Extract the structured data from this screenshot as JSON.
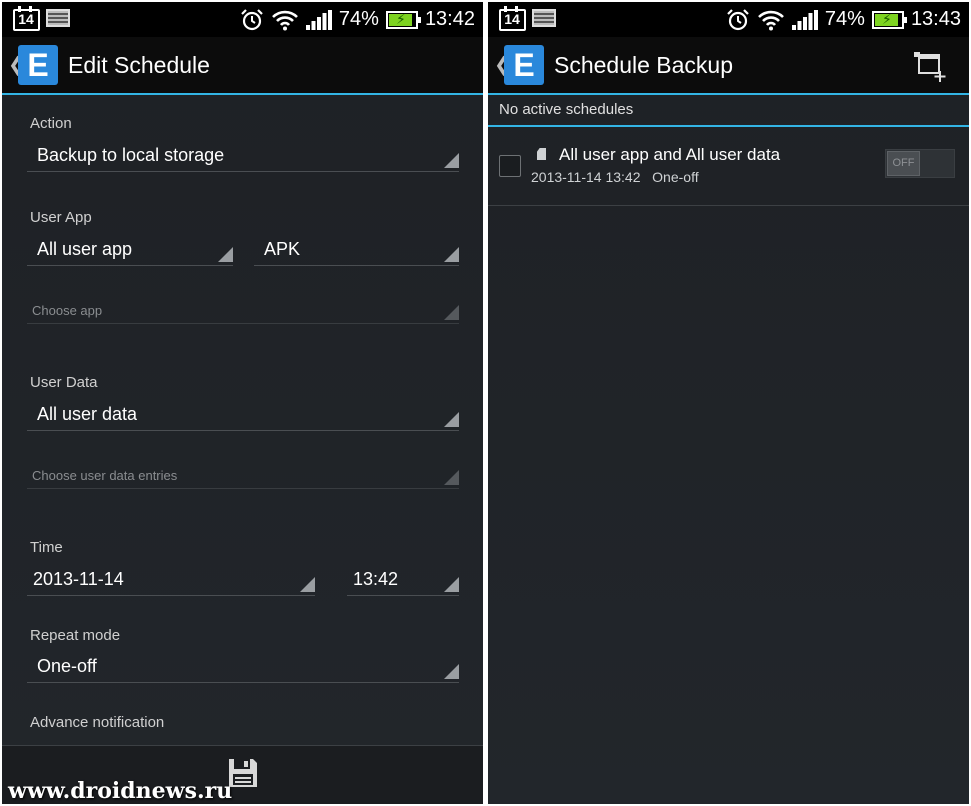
{
  "status_left": {
    "calendar_day": "14",
    "battery": "74%",
    "time": "13:42"
  },
  "status_right": {
    "calendar_day": "14",
    "battery": "74%",
    "time": "13:43"
  },
  "edit_screen": {
    "title": "Edit Schedule",
    "action": {
      "label": "Action",
      "value": "Backup to local storage"
    },
    "user_app": {
      "label": "User App",
      "value": "All user app",
      "type": "APK",
      "choose_hint": "Choose app"
    },
    "user_data": {
      "label": "User Data",
      "value": "All user data",
      "choose_hint": "Choose user data entries"
    },
    "time": {
      "label": "Time",
      "date": "2013-11-14",
      "time": "13:42"
    },
    "repeat": {
      "label": "Repeat mode",
      "value": "One-off"
    },
    "advance_notification": {
      "label": "Advance notification"
    }
  },
  "schedule_screen": {
    "title": "Schedule Backup",
    "notice": "No active schedules",
    "items": [
      {
        "title": "All user app and All user data",
        "date": "2013-11-14 13:42",
        "mode": "One-off",
        "toggle": "OFF"
      }
    ]
  },
  "watermark": "www.droidnews.ru",
  "colors": {
    "accent": "#33b5e5",
    "logo": "#2a88db",
    "battery": "#7ed321"
  }
}
